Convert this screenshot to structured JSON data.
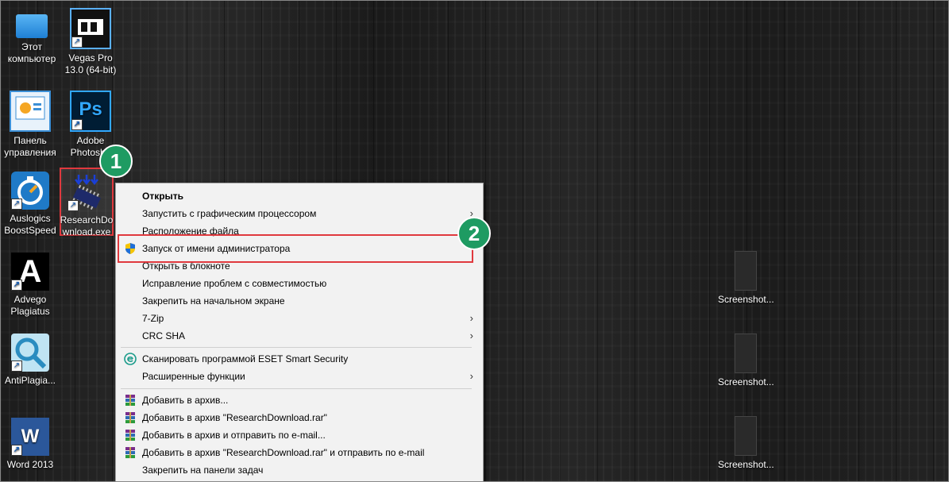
{
  "desktop_icons": [
    {
      "name": "this-pc",
      "label": "Этот компьютер",
      "icon": "computer-icon"
    },
    {
      "name": "vegas",
      "label": "Vegas Pro 13.0 (64-bit)",
      "icon": "film-icon"
    },
    {
      "name": "control-panel",
      "label": "Панель управления",
      "icon": "control-panel-icon"
    },
    {
      "name": "photoshop",
      "label": "Adobe Photosho",
      "icon": "photoshop-icon"
    },
    {
      "name": "auslogics",
      "label": "Auslogics BoostSpeed",
      "icon": "boostspeed-icon"
    },
    {
      "name": "research",
      "label": "ResearchDownload.exe",
      "icon": "chip-icon"
    },
    {
      "name": "advego",
      "label": "Advego Plagiatus",
      "icon": "letter-a-icon"
    },
    {
      "name": "antiplagiat",
      "label": "AntiPlagia...",
      "icon": "magnifier-icon"
    },
    {
      "name": "word",
      "label": "Word 2013",
      "icon": "word-icon"
    },
    {
      "name": "shot1",
      "label": "Screenshot...",
      "icon": "screenshot-thumb"
    },
    {
      "name": "shot2",
      "label": "Screenshot...",
      "icon": "screenshot-thumb"
    },
    {
      "name": "shot3",
      "label": "Screenshot...",
      "icon": "screenshot-thumb"
    }
  ],
  "ps_glyph": "Ps",
  "advego_glyph": "A",
  "word_glyph": "W",
  "annotations": {
    "badge1": "1",
    "badge2": "2"
  },
  "context_menu": {
    "items": [
      {
        "label": "Открыть"
      },
      {
        "label": "Запустить с графическим процессором"
      },
      {
        "label": "Расположение файла"
      },
      {
        "label": "Запуск от имени администратора"
      },
      {
        "label": "Открыть в блокноте"
      },
      {
        "label": "Исправление проблем с совместимостью"
      },
      {
        "label": "Закрепить на начальном экране"
      },
      {
        "label": "7-Zip"
      },
      {
        "label": "CRC SHA"
      },
      {
        "label": "Сканировать программой ESET Smart Security"
      },
      {
        "label": "Расширенные функции"
      },
      {
        "label": "Добавить в архив..."
      },
      {
        "label": "Добавить в архив \"ResearchDownload.rar\""
      },
      {
        "label": "Добавить в архив и отправить по e-mail..."
      },
      {
        "label": "Добавить в архив \"ResearchDownload.rar\" и отправить по e-mail"
      },
      {
        "label": "Закрепить на панели задач"
      }
    ],
    "arrow_glyph": "›"
  },
  "colors": {
    "highlight": "#e0393e",
    "badge": "#1e9b62"
  }
}
